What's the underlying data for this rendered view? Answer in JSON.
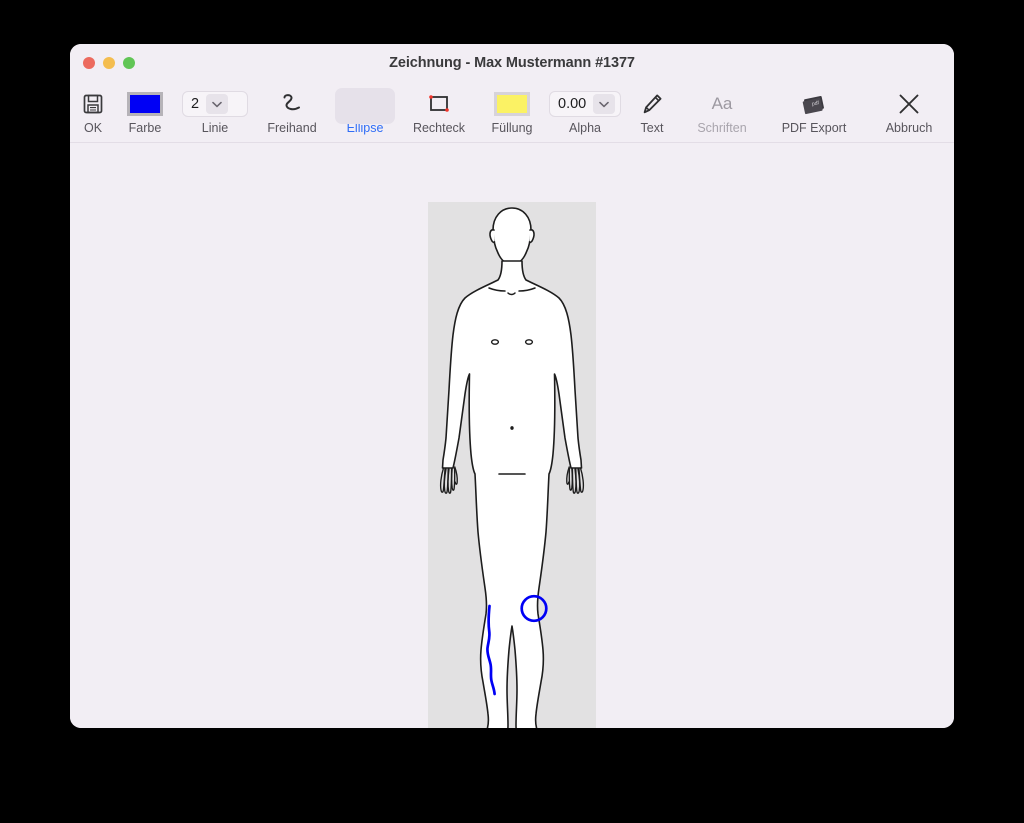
{
  "window": {
    "title": "Zeichnung - Max Mustermann #1377",
    "traffic_lights": [
      {
        "name": "close",
        "color": "#ec6a5e"
      },
      {
        "name": "minimize",
        "color": "#f4bd4f"
      },
      {
        "name": "maximize",
        "color": "#61c555"
      }
    ]
  },
  "toolbar": {
    "items": [
      {
        "id": "ok",
        "label": "OK",
        "icon": "floppy-disk-save-icon",
        "state": "normal"
      },
      {
        "id": "farbe",
        "label": "Farbe",
        "icon": "color-swatch-icon",
        "state": "normal",
        "value": "#0000f5"
      },
      {
        "id": "linie",
        "label": "Linie",
        "icon": "stepper-icon",
        "state": "normal",
        "value": "2"
      },
      {
        "id": "freihand",
        "label": "Freihand",
        "icon": "freehand-scribble-icon",
        "state": "normal"
      },
      {
        "id": "ellipse",
        "label": "Ellipse",
        "icon": "ellipse-icon",
        "state": "selected"
      },
      {
        "id": "rechteck",
        "label": "Rechteck",
        "icon": "rectangle-icon",
        "state": "normal"
      },
      {
        "id": "fuellung",
        "label": "Füllung",
        "icon": "fill-swatch-icon",
        "state": "normal",
        "value": "#fbf264"
      },
      {
        "id": "alpha",
        "label": "Alpha",
        "icon": "stepper-icon",
        "state": "normal",
        "value": "0.00"
      },
      {
        "id": "text",
        "label": "Text",
        "icon": "pencil-icon",
        "state": "normal"
      },
      {
        "id": "schriften",
        "label": "Schriften",
        "icon": "font-aa-icon",
        "state": "disabled"
      },
      {
        "id": "pdfexport",
        "label": "PDF Export",
        "icon": "pdf-document-icon",
        "state": "normal"
      },
      {
        "id": "abbruch",
        "label": "Abbruch",
        "icon": "close-x-icon",
        "state": "normal"
      }
    ],
    "stroke_color": "#0000f5",
    "fill_color": "#fbf264",
    "line_width": "2",
    "alpha": "0.00"
  },
  "canvas": {
    "name": "body-diagram-canvas",
    "background_color": "#e2e1e2",
    "figure": "male-anatomical-body-front-view",
    "annotations": [
      {
        "type": "freehand",
        "name": "freehand-mark-left-shin",
        "color": "#0000f5",
        "stroke_width": 2.6
      },
      {
        "type": "ellipse",
        "name": "ellipse-mark-right-knee",
        "color": "#0000f5",
        "stroke_width": 2.6
      }
    ]
  }
}
